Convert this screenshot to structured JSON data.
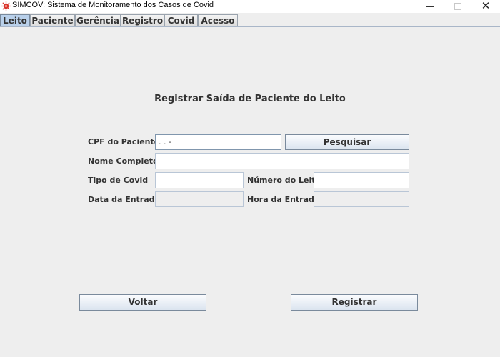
{
  "window": {
    "title": "SIMCOV: Sistema de Monitoramento dos Casos de Covid",
    "close_glyph": "✕"
  },
  "tabs": [
    "Leito",
    "Paciente",
    "Gerência",
    "Registro",
    "Covid",
    "Acesso"
  ],
  "active_tab": "Leito",
  "form": {
    "heading": "Registrar Saída de Paciente do Leito",
    "cpf_label": "CPF do Paciente",
    "cpf_value": ".  .  -",
    "search_button": "Pesquisar",
    "name_label": "Nome Completo",
    "name_value": "",
    "covid_type_label": "Tipo de Covid",
    "covid_type_value": "",
    "bed_number_label": "Número do Leito",
    "bed_number_value": "",
    "entry_date_label": "Data da Entrada",
    "entry_date_value": "",
    "entry_time_label": "Hora da Entrada",
    "entry_time_value": ""
  },
  "footer": {
    "back_button": "Voltar",
    "register_button": "Registrar"
  },
  "colors": {
    "background": "#eeeeee",
    "active_tab": "#b9d0ea",
    "icon_red": "#d9342b"
  },
  "icons": [
    "virus-icon",
    "minimize-icon",
    "maximize-icon",
    "close-icon"
  ]
}
